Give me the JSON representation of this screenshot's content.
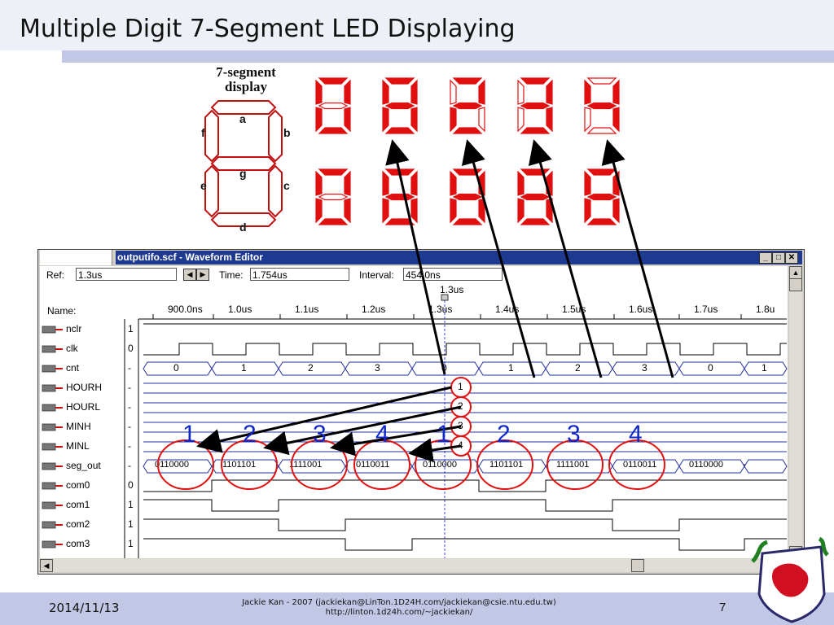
{
  "slide": {
    "title": "Multiple Digit 7-Segment LED Displaying",
    "date": "2014/11/13",
    "footer_line1": "Jackie Kan - 2007 (jackiekan@LinTon.1D24H.com/jackiekan@csie.ntu.edu.tw)",
    "footer_line2": "http://linton.1d24h.com/~jackiekan/",
    "page": "7"
  },
  "diagram": {
    "label_line1": "7-segment",
    "label_line2": "display",
    "segments": [
      "a",
      "b",
      "c",
      "d",
      "e",
      "f",
      "g"
    ],
    "led_color": "#e01010",
    "top_row_digits": [
      "0",
      "8",
      "2",
      "3",
      "4"
    ],
    "bottom_row_digits": [
      "0",
      "8",
      "8",
      "8",
      "8"
    ]
  },
  "window": {
    "title": "outputifo.scf - Waveform Editor",
    "ref_label": "Ref:",
    "ref_value": "1.3us",
    "time_label": "Time:",
    "time_value": "1.754us",
    "interval_label": "Interval:",
    "interval_value": "454.0ns",
    "cursor_label": "1.3us",
    "name_header": "Name:",
    "ticks": [
      "900.0ns",
      "1.0us",
      "1.1us",
      "1.2us",
      "1.3us",
      "1.4us",
      "1.5us",
      "1.6us",
      "1.7us",
      "1.8u"
    ]
  },
  "signals": [
    {
      "name": "nclr",
      "value": "1"
    },
    {
      "name": "clk",
      "value": "0"
    },
    {
      "name": "cnt",
      "value": "-"
    },
    {
      "name": "HOURH",
      "value": "-"
    },
    {
      "name": "HOURL",
      "value": "-"
    },
    {
      "name": "MINH",
      "value": "-"
    },
    {
      "name": "MINL",
      "value": "-"
    },
    {
      "name": "seg_out",
      "value": "-"
    },
    {
      "name": "com0",
      "value": "0"
    },
    {
      "name": "com1",
      "value": "1"
    },
    {
      "name": "com2",
      "value": "1"
    },
    {
      "name": "com3",
      "value": "1"
    }
  ],
  "cnt_values": [
    "0",
    "1",
    "2",
    "3",
    "0",
    "1",
    "2",
    "3",
    "0",
    "1"
  ],
  "seg_values": [
    "0110000",
    "1101101",
    "1111001",
    "0110011",
    "0110000",
    "1101101",
    "1111001",
    "0110011",
    "0110000",
    "-"
  ],
  "annotations": {
    "circle_numbers": [
      "1",
      "2",
      "3",
      "4"
    ],
    "big_numbers": [
      "1",
      "2",
      "3",
      "4",
      "1",
      "2",
      "3",
      "4"
    ]
  }
}
